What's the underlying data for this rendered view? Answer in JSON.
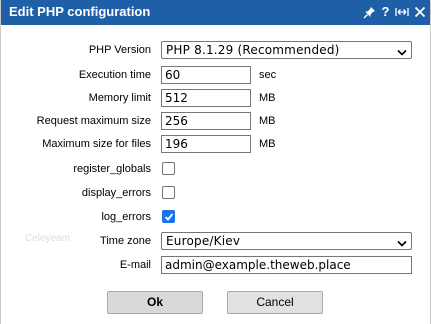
{
  "dialog": {
    "title": "Edit PHP configuration",
    "icons": [
      "pin-icon",
      "help-icon",
      "expand-icon",
      "close-icon"
    ],
    "help_glyph": "?"
  },
  "background_text": {
    "left": "Celeyeam",
    "right": ""
  },
  "form": {
    "php_version": {
      "label": "PHP Version",
      "value": "PHP 8.1.29 (Recommended)"
    },
    "execution_time": {
      "label": "Execution time",
      "value": "60",
      "unit": "sec"
    },
    "memory_limit": {
      "label": "Memory limit",
      "value": "512",
      "unit": "MB"
    },
    "request_max_size": {
      "label": "Request maximum size",
      "value": "256",
      "unit": "MB"
    },
    "max_file_size": {
      "label": "Maximum size for files",
      "value": "196",
      "unit": "MB"
    },
    "register_globals": {
      "label": "register_globals",
      "checked": false
    },
    "display_errors": {
      "label": "display_errors",
      "checked": false
    },
    "log_errors": {
      "label": "log_errors",
      "checked": true
    },
    "time_zone": {
      "label": "Time zone",
      "value": "Europe/Kiev"
    },
    "email": {
      "label": "E-mail",
      "value": "admin@example.theweb.place"
    }
  },
  "buttons": {
    "ok_label": "Ok",
    "cancel_label": "Cancel"
  },
  "colors": {
    "titlebar": "#1f5fa8",
    "checkbox_checked": "#1a73e8",
    "button_bg": "#dcdcdc"
  }
}
